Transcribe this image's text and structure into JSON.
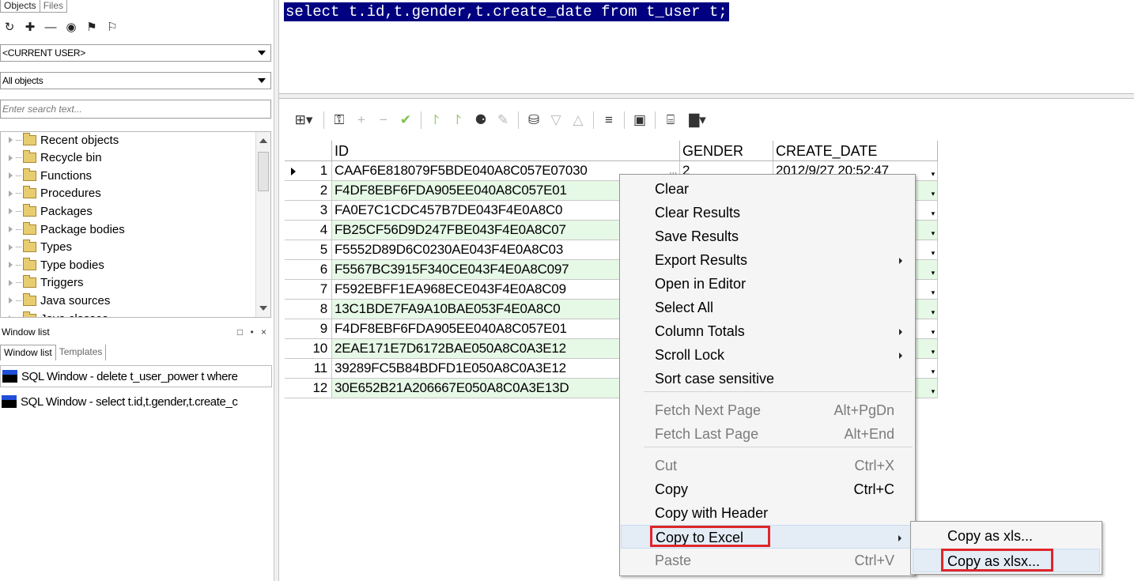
{
  "left_panel": {
    "tabs": [
      "Objects",
      "Files"
    ],
    "toolbar_icons": [
      "refresh-icon",
      "add-icon",
      "remove-icon",
      "find-icon",
      "filter-icon",
      "filter-clear-icon"
    ],
    "toolbar_glyphs": [
      "↻",
      "✚",
      "—",
      "◉",
      "⚑",
      "⚐"
    ],
    "user_combo": "<CURRENT USER>",
    "objects_combo": "All objects",
    "search_placeholder": "Enter search text...",
    "tree_items": [
      "Recent objects",
      "Recycle bin",
      "Functions",
      "Procedures",
      "Packages",
      "Package bodies",
      "Types",
      "Type bodies",
      "Triggers",
      "Java sources",
      "Java classes"
    ],
    "window_list_title": "Window list",
    "window_list_controls": "□ • ×",
    "window_list_tabs": [
      "Window list",
      "Templates"
    ],
    "window_list_items": [
      "SQL Window - delete t_user_power t where",
      "SQL Window - select t.id,t.gender,t.create_c"
    ]
  },
  "editor": {
    "sql": "select t.id,t.gender,t.create_date from t_user t;"
  },
  "grid": {
    "columns": [
      "ID",
      "GENDER",
      "CREATE_DATE"
    ],
    "rows": [
      {
        "num": "1",
        "id": "CAAF6E818079F5BDE040A8C057E07030",
        "gender": "2",
        "date": "2012/9/27 20:52:47"
      },
      {
        "num": "2",
        "id": "F4DF8EBF6FDA905EE040A8C057E01",
        "gender": "",
        "date": ""
      },
      {
        "num": "3",
        "id": "FA0E7C1CDC457B7DE043F4E0A8C0",
        "gender": "",
        "date": ""
      },
      {
        "num": "4",
        "id": "FB25CF56D9D247FBE043F4E0A8C07",
        "gender": "",
        "date": ""
      },
      {
        "num": "5",
        "id": "F5552D89D6C0230AE043F4E0A8C03",
        "gender": "",
        "date": ""
      },
      {
        "num": "6",
        "id": "F5567BC3915F340CE043F4E0A8C097",
        "gender": "",
        "date": ""
      },
      {
        "num": "7",
        "id": "F592EBFF1EA968ECE043F4E0A8C09",
        "gender": "",
        "date": ""
      },
      {
        "num": "8",
        "id": "13C1BDE7FA9A10BAE053F4E0A8C0",
        "gender": "",
        "date": ""
      },
      {
        "num": "9",
        "id": "F4DF8EBF6FDA905EE040A8C057E01",
        "gender": "",
        "date": ""
      },
      {
        "num": "10",
        "id": "2EAE171E7D6172BAE050A8C0A3E12",
        "gender": "",
        "date": ""
      },
      {
        "num": "11",
        "id": "39289FC5B84BDFD1E050A8C0A3E12",
        "gender": "",
        "date": ""
      },
      {
        "num": "12",
        "id": "30E652B21A206667E050A8C0A3E13D",
        "gender": "",
        "date": ""
      }
    ],
    "toolbar": {
      "icons": [
        "grid-view-icon",
        "lock-icon",
        "add-record-icon",
        "delete-record-icon",
        "post-icon",
        "next-page-icon",
        "last-page-icon",
        "find-icon",
        "clear-icon",
        "query-by-example-icon",
        "filter-down-icon",
        "filter-up-icon",
        "export-icon",
        "save-icon",
        "print-icon",
        "chart-icon"
      ],
      "glyphs": [
        "⊞▾",
        "⚿",
        "+",
        "−",
        "✔",
        "⨡",
        "⨡",
        "⚈",
        "✎",
        "⛁",
        "▽",
        "△",
        "≡",
        "▣",
        "⌸",
        "▇▾"
      ]
    }
  },
  "context_menu": {
    "items": [
      {
        "label": "Clear",
        "shortcut": "",
        "submenu": false,
        "disabled": false
      },
      {
        "label": "Clear Results",
        "shortcut": "",
        "submenu": false,
        "disabled": false
      },
      {
        "label": "Save Results",
        "shortcut": "",
        "submenu": false,
        "disabled": false
      },
      {
        "label": "Export Results",
        "shortcut": "",
        "submenu": true,
        "disabled": false
      },
      {
        "label": "Open in Editor",
        "shortcut": "",
        "submenu": false,
        "disabled": false
      },
      {
        "label": "Select All",
        "shortcut": "",
        "submenu": false,
        "disabled": false
      },
      {
        "label": "Column Totals",
        "shortcut": "",
        "submenu": true,
        "disabled": false
      },
      {
        "label": "Scroll Lock",
        "shortcut": "",
        "submenu": true,
        "disabled": false
      },
      {
        "label": "Sort case sensitive",
        "shortcut": "",
        "submenu": false,
        "disabled": false
      },
      {
        "label": "Fetch Next Page",
        "shortcut": "Alt+PgDn",
        "submenu": false,
        "disabled": true
      },
      {
        "label": "Fetch Last Page",
        "shortcut": "Alt+End",
        "submenu": false,
        "disabled": true
      },
      {
        "label": "Cut",
        "shortcut": "Ctrl+X",
        "submenu": false,
        "disabled": true
      },
      {
        "label": "Copy",
        "shortcut": "Ctrl+C",
        "submenu": false,
        "disabled": false
      },
      {
        "label": "Copy with Header",
        "shortcut": "",
        "submenu": false,
        "disabled": false
      },
      {
        "label": "Copy to Excel",
        "shortcut": "",
        "submenu": true,
        "disabled": false
      },
      {
        "label": "Paste",
        "shortcut": "Ctrl+V",
        "submenu": false,
        "disabled": true
      }
    ],
    "submenu_items": [
      "Copy as xls...",
      "Copy as xlsx..."
    ]
  },
  "colors": {
    "selection_bg": "#000080",
    "row_green": "#e6f8e6",
    "highlight_red": "#e0262a",
    "menu_bg": "#f5f5f5"
  }
}
